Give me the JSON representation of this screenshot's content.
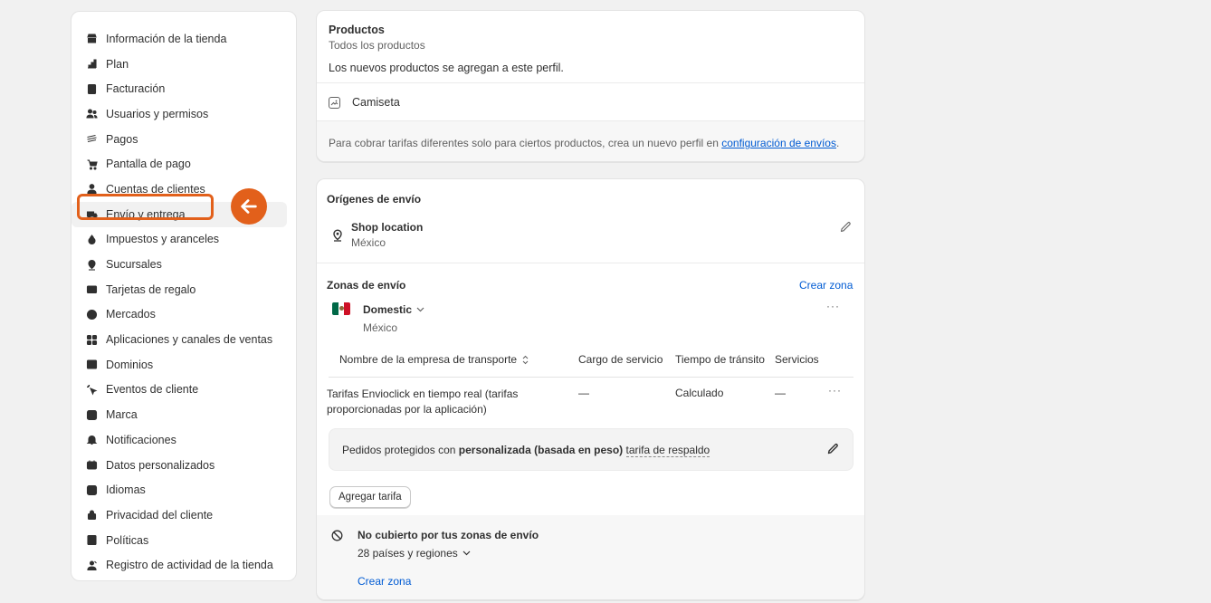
{
  "sidebar": {
    "items": [
      {
        "label": "Información de la tienda",
        "icon": "store-icon"
      },
      {
        "label": "Plan",
        "icon": "plan-icon"
      },
      {
        "label": "Facturación",
        "icon": "billing-icon"
      },
      {
        "label": "Usuarios y permisos",
        "icon": "users-icon"
      },
      {
        "label": "Pagos",
        "icon": "payments-icon"
      },
      {
        "label": "Pantalla de pago",
        "icon": "checkout-icon"
      },
      {
        "label": "Cuentas de clientes",
        "icon": "customer-accounts-icon"
      },
      {
        "label": "Envío y entrega",
        "icon": "delivery-truck-icon"
      },
      {
        "label": "Impuestos y aranceles",
        "icon": "taxes-icon"
      },
      {
        "label": "Sucursales",
        "icon": "location-pin-icon"
      },
      {
        "label": "Tarjetas de regalo",
        "icon": "gift-card-icon"
      },
      {
        "label": "Mercados",
        "icon": "globe-icon"
      },
      {
        "label": "Aplicaciones y canales de ventas",
        "icon": "apps-icon"
      },
      {
        "label": "Dominios",
        "icon": "domains-icon"
      },
      {
        "label": "Eventos de cliente",
        "icon": "cursor-click-icon"
      },
      {
        "label": "Marca",
        "icon": "brand-icon"
      },
      {
        "label": "Notificaciones",
        "icon": "bell-icon"
      },
      {
        "label": "Datos personalizados",
        "icon": "custom-data-icon"
      },
      {
        "label": "Idiomas",
        "icon": "languages-icon"
      },
      {
        "label": "Privacidad del cliente",
        "icon": "lock-icon"
      },
      {
        "label": "Políticas",
        "icon": "policies-icon"
      },
      {
        "label": "Registro de actividad de la tienda",
        "icon": "activity-log-icon"
      }
    ],
    "active_index": 7
  },
  "products_card": {
    "title": "Productos",
    "subtitle": "Todos los productos",
    "note": "Los nuevos productos se agregan a este perfil.",
    "product_name": "Camiseta",
    "footer_text": "Para cobrar tarifas diferentes solo para ciertos productos, crea un nuevo perfil en ",
    "footer_link": "configuración de envíos",
    "footer_end": "."
  },
  "origins": {
    "title": "Orígenes de envío",
    "location_name": "Shop location",
    "location_country": "México"
  },
  "zones": {
    "title": "Zonas de envío",
    "create_link": "Crear zona",
    "zone_name": "Domestic",
    "zone_country": "México",
    "columns": {
      "carrier": "Nombre de la empresa de transporte",
      "fee": "Cargo de servicio",
      "transit": "Tiempo de tránsito",
      "services": "Servicios"
    },
    "row": {
      "carrier_line1": "Tarifas Envioclick en tiempo real (tarifas",
      "carrier_line2": "proporcionadas por la aplicación)",
      "fee": "—",
      "transit": "Calculado",
      "services": "—"
    },
    "backup": {
      "prefix": "Pedidos protegidos con ",
      "bold": "personalizada (basada en peso)",
      "link": "tarifa de respaldo"
    },
    "add_rate_button": "Agregar tarifa"
  },
  "not_covered": {
    "title": "No cubierto por tus zonas de envío",
    "count": "28 países y regiones",
    "create_link": "Crear zona"
  },
  "colors": {
    "accent_orange": "#e2601b",
    "link_blue": "#005bd3"
  }
}
